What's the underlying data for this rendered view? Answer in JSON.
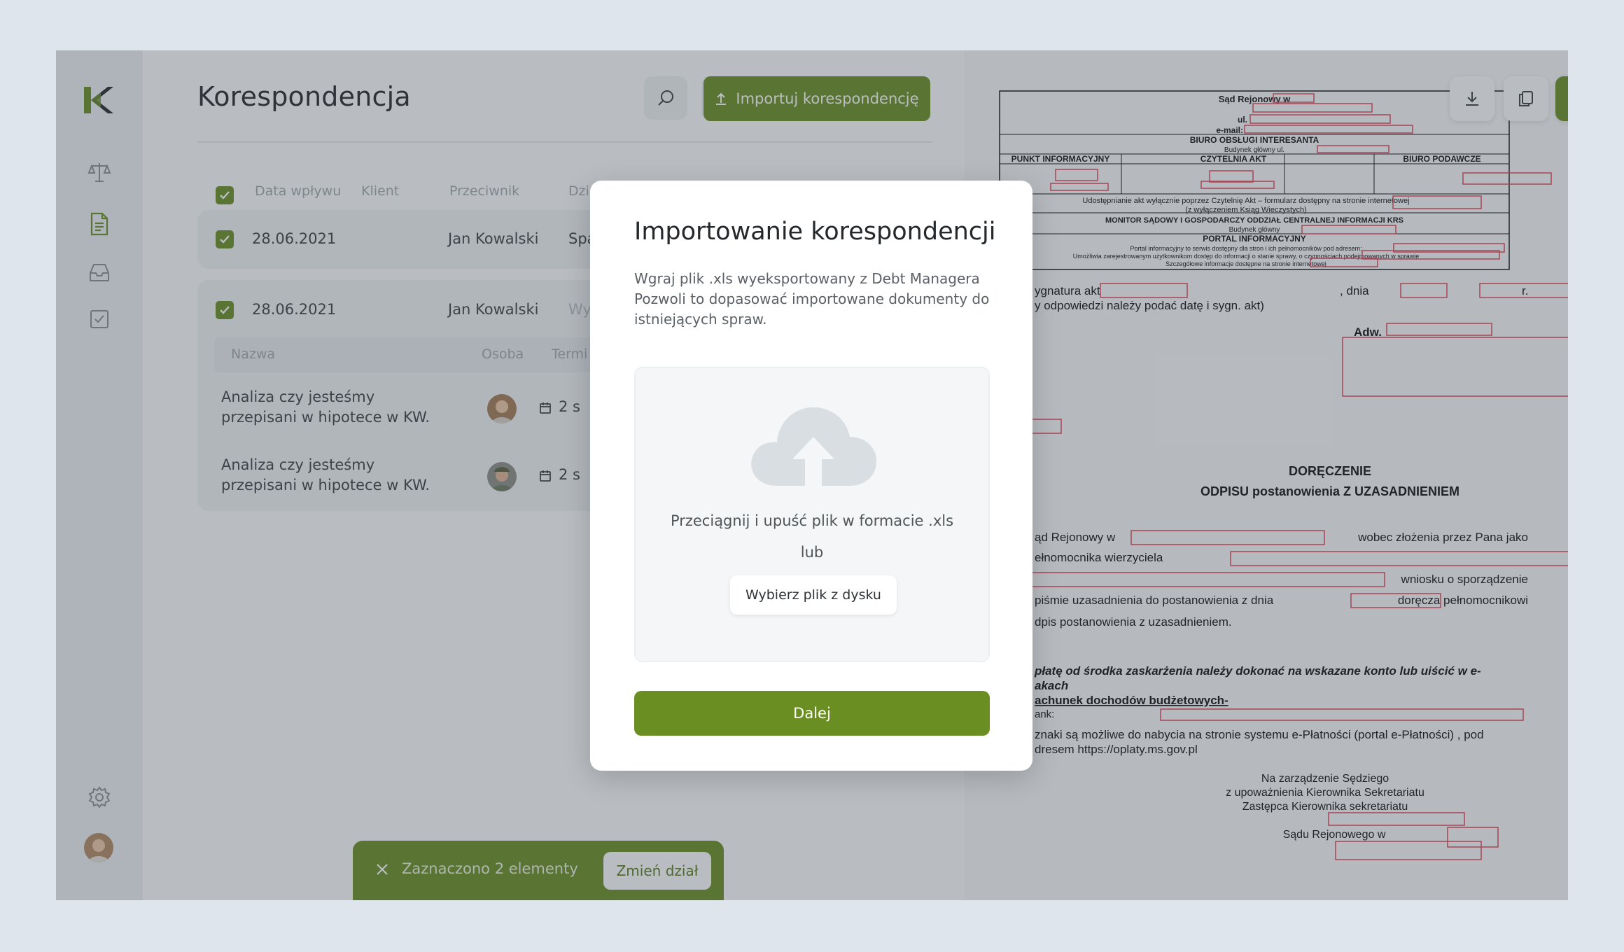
{
  "header": {
    "title": "Korespondencja",
    "import_label": "Importuj korespondencję"
  },
  "table": {
    "columns": [
      "Data wpływu",
      "Klient",
      "Przeciwnik",
      "Dzi"
    ],
    "rows": [
      {
        "date": "28.06.2021",
        "client": "Jan Kowalski",
        "extra": "Spa"
      },
      {
        "date": "28.06.2021",
        "client": "Jan Kowalski",
        "extra": "Wy"
      }
    ],
    "subtable": {
      "columns": [
        "Nazwa",
        "Osoba",
        "Termi"
      ],
      "tasks": [
        {
          "name": "Analiza czy jesteśmy przepisani w hipotece w KW.",
          "term": "2 s"
        },
        {
          "name": "Analiza czy jesteśmy przepisani w hipotece w KW.",
          "term": "2 s"
        }
      ]
    }
  },
  "toast": {
    "text": "Zaznaczono 2 elementy",
    "button": "Zmień dział"
  },
  "modal": {
    "title": "Importowanie korespondencji",
    "description": "Wgraj plik .xls wyeksportowany z Debt Managera Pozwoli to dopasować importowane dokumenty do istniejących spraw.",
    "drop_text": "Przeciągnij i upuść plik w formacie .xls",
    "or_text": "lub",
    "choose_button": "Wybierz plik z dysku",
    "next_button": "Dalej"
  },
  "document": {
    "court": "Sąd Rejonowy w",
    "ul": "ul.",
    "email": "e-mail:",
    "biuro": "BIURO OBSŁUGI INTERESANTA",
    "budynek": "Budynek główny ul.",
    "cols": [
      "PUNKT INFORMACYJNY",
      "CZYTELNIA AKT",
      "BIURO PODAWCZE"
    ],
    "udostep": "Udostępnianie akt wyłącznie poprzez Czytelnię Akt – formularz dostępny na stronie internetowej",
    "udostep2": "(z wyłączeniem Ksiąg Wieczystych)",
    "monitor": "MONITOR SĄDOWY I GOSPODARCZY ODDZIAŁ CENTRALNEJ INFORMACJI KRS",
    "budynek2": "Budynek główny",
    "portal": "PORTAL INFORMACYJNY",
    "portal1": "Portal informacyjny to serwis dostępny dla stron i ich pełnomocników pod adresem:",
    "portal2": "Umożliwia zarejestrowanym użytkownikom dostęp do informacji o stanie sprawy, o czynnościach podejmowanych w sprawie",
    "portal3": "Szczegółowe informacje dostępne na stronie internetowej",
    "sygn": "ygnatura akt",
    "dnia": ", dnia",
    "r": "r.",
    "odp": "y odpowiedzi należy podać datę i sygn. akt)",
    "adw": "Adw.",
    "doreczenie": "DORĘCZENIE",
    "odpis": "ODPISU postanowienia Z UZASADNIENIEM",
    "p1a": "ąd  Rejonowy  w",
    "p1b": "wobec  złożenia  przez  Pana  jako",
    "p2": "ełnomocnika   wierzyciela",
    "p3": "wniosku o sporządzenie",
    "p4a": "piśmie uzasadnienia do postanowienia z dnia",
    "p4b": "doręcza pełnomocnikowi",
    "p5": "dpis postanowienia z uzasadnieniem.",
    "opl1": "płatę od środka zaskarżenia należy dokonać  na  wskazane konto lub uiścić w e-",
    "opl2": "akach",
    "opl3": "achunek dochodów budżetowych-",
    "bank": "ank:",
    "znaki": "znaki są możliwe do nabycia na stronie systemu e-Płatności (portal e-Płatności) , pod",
    "adres": "dresem https://oplaty.ms.gov.pl",
    "sig1": "Na zarządzenie Sędziego",
    "sig2": "z upoważnienia Kierownika Sekretariatu",
    "sig3": "Zastępca Kierownika sekretariatu",
    "sig4": "Sądu Rejonowego w"
  },
  "colors": {
    "accent": "#6b8e23",
    "redact": "#e0465a"
  },
  "icons": [
    "logo-icon",
    "scales-icon",
    "document-icon",
    "inbox-icon",
    "checkbox-icon",
    "settings-icon",
    "search-icon",
    "filter-icon",
    "upload-icon",
    "close-icon",
    "calendar-icon",
    "cloud-upload-icon",
    "download-icon",
    "copy-icon",
    "external-link-icon"
  ]
}
